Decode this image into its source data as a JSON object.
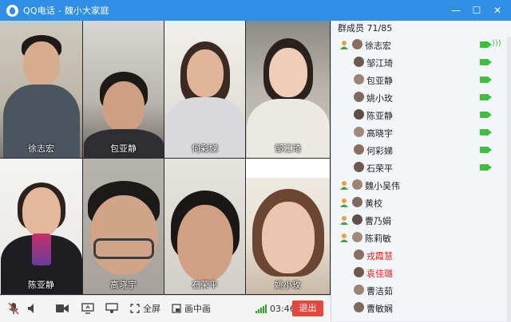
{
  "window": {
    "app": "QQ电话",
    "separator": " - ",
    "group": "魏小大家庭"
  },
  "window_buttons": {
    "minimize": "—",
    "maximize": "☐",
    "close": "✕"
  },
  "members_header": "群成员 71/85",
  "video_tiles": [
    {
      "name": "徐志宏"
    },
    {
      "name": "包亚静"
    },
    {
      "name": "何彩娣"
    },
    {
      "name": "邹江琦"
    },
    {
      "name": "陈亚静"
    },
    {
      "name": "高晓宇"
    },
    {
      "name": "石荣平"
    },
    {
      "name": "姚小玫"
    }
  ],
  "members": [
    {
      "name": "徐志宏",
      "role": "admin",
      "indent": 0,
      "camera": true,
      "speaking": true,
      "color": "normal"
    },
    {
      "name": "邹江琦",
      "role": "",
      "indent": 1,
      "camera": true,
      "speaking": false,
      "color": "normal"
    },
    {
      "name": "包亚静",
      "role": "",
      "indent": 1,
      "camera": true,
      "speaking": false,
      "color": "normal"
    },
    {
      "name": "姚小玫",
      "role": "",
      "indent": 1,
      "camera": true,
      "speaking": false,
      "color": "normal"
    },
    {
      "name": "陈亚静",
      "role": "",
      "indent": 1,
      "camera": true,
      "speaking": false,
      "color": "normal"
    },
    {
      "name": "高晓宇",
      "role": "",
      "indent": 1,
      "camera": true,
      "speaking": false,
      "color": "normal"
    },
    {
      "name": "何彩娣",
      "role": "",
      "indent": 1,
      "camera": true,
      "speaking": false,
      "color": "normal"
    },
    {
      "name": "石荣平",
      "role": "",
      "indent": 1,
      "camera": true,
      "speaking": false,
      "color": "normal"
    },
    {
      "name": "魏小吴伟",
      "role": "admin",
      "indent": 0,
      "camera": false,
      "speaking": false,
      "color": "normal"
    },
    {
      "name": "黄校",
      "role": "admin",
      "indent": 0,
      "camera": false,
      "speaking": false,
      "color": "normal"
    },
    {
      "name": "曹乃娟",
      "role": "admin",
      "indent": 0,
      "camera": false,
      "speaking": false,
      "color": "normal"
    },
    {
      "name": "陈莉敏",
      "role": "admin",
      "indent": 0,
      "camera": false,
      "speaking": false,
      "color": "normal"
    },
    {
      "name": "戎霞慧",
      "role": "",
      "indent": 1,
      "camera": false,
      "speaking": false,
      "color": "red"
    },
    {
      "name": "袁佳璐",
      "role": "",
      "indent": 1,
      "camera": false,
      "speaking": false,
      "color": "red"
    },
    {
      "name": "曹洁茹",
      "role": "",
      "indent": 1,
      "camera": false,
      "speaking": false,
      "color": "normal"
    },
    {
      "name": "曹敏娴",
      "role": "",
      "indent": 1,
      "camera": false,
      "speaking": false,
      "color": "normal"
    }
  ],
  "toolbar": {
    "fullscreen_label": "全屏",
    "pip_label": "画中画",
    "duration": "03:46",
    "hangup_label": "退出"
  },
  "colors": {
    "titlebar": "#2f8ee6",
    "accent_green": "#3fbf3f",
    "hangup": "#e8453c",
    "red_name": "#e02020"
  }
}
